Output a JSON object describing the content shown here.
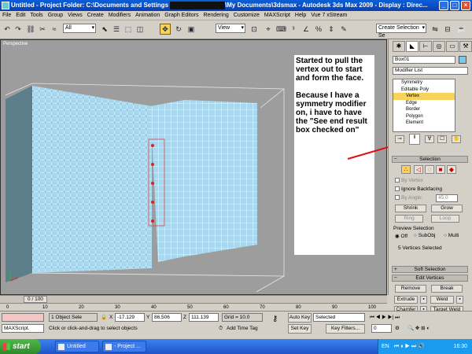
{
  "titlebar": {
    "title_left": "Untitled    - Project Folder: C:\\Documents and Settings",
    "title_right": "\\My Documents\\3dsmax    - Autodesk 3ds Max  2009       - Display : Direc...",
    "minimize": "_",
    "maximize": "□",
    "close": "×"
  },
  "menu": [
    "File",
    "Edit",
    "Tools",
    "Group",
    "Views",
    "Create",
    "Modifiers",
    "Animation",
    "Graph Editors",
    "Rendering",
    "Customize",
    "MAXScript",
    "Help",
    "Vue 7 xStream"
  ],
  "toolbar": {
    "filter_value": "All",
    "refcoord_value": "View",
    "selection_set_placeholder": "Create Selection Se"
  },
  "viewport": {
    "label": "Perspective"
  },
  "annotation": {
    "para1": "Started to pull the vertex out to start and form the face.",
    "para2": "Because I have a symmetry modifier on, i have to have the \"See end result box checked on\""
  },
  "command_panel": {
    "object_name": "Box01",
    "modifier_list": "Modifier List",
    "stack": [
      {
        "label": "Symmetry",
        "level": 0,
        "selected": false
      },
      {
        "label": "Editable Poly",
        "level": 0,
        "selected": false
      },
      {
        "label": "Vertex",
        "level": 1,
        "selected": true
      },
      {
        "label": "Edge",
        "level": 1,
        "selected": false
      },
      {
        "label": "Border",
        "level": 1,
        "selected": false
      },
      {
        "label": "Polygon",
        "level": 1,
        "selected": false
      },
      {
        "label": "Element",
        "level": 1,
        "selected": false
      }
    ],
    "selection_rollout": "Selection",
    "by_vertex": "By Vertex",
    "ignore_backfacing": "Ignore Backfacing",
    "by_angle": "By Angle:",
    "by_angle_value": "45.0",
    "shrink": "Shrink",
    "grow": "Grow",
    "ring": "Ring",
    "loop": "Loop",
    "preview_selection": "Preview Selection",
    "preview_off": "Off",
    "preview_subobj": "SubObj",
    "preview_multi": "Multi",
    "selected_count": "5 Vertices Selected",
    "soft_selection": "Soft Selection",
    "edit_vertices": "Edit Vertices",
    "remove": "Remove",
    "break": "Break",
    "extrude": "Extrude",
    "weld": "Weld",
    "chamfer": "Chamfer",
    "target_weld": "Target Weld"
  },
  "timeline": {
    "frame": "0 / 100"
  },
  "trackbar_ticks": [
    "0",
    "10",
    "20",
    "30",
    "40",
    "50",
    "60",
    "70",
    "80",
    "90",
    "100"
  ],
  "status": {
    "listener": "MAXScript.",
    "objects_selected": "1 Object Sele",
    "x_label": "X",
    "x_value": "-17.129",
    "y_label": "Y",
    "y_value": "86.506",
    "z_label": "Z",
    "z_value": "111.139",
    "grid": "Grid = 10.0",
    "prompt": "Click or click-and-drag to select objects",
    "add_time_tag": "Add Time Tag",
    "auto_key": "Auto Key",
    "set_key": "Set Key",
    "selected_dropdown": "Selected",
    "key_filters": "Key Filters...",
    "frame_field": "0"
  },
  "taskbar": {
    "start": "start",
    "tasks": [
      "Untitled",
      "- Project ..."
    ],
    "lang": "EN",
    "clock": "16:30"
  },
  "colors": {
    "accent_yellow": "#f7d35a",
    "face_blue": "#a9d8ee",
    "vertex_orange": "#e08a1e",
    "annotation_red": "#e01010"
  }
}
